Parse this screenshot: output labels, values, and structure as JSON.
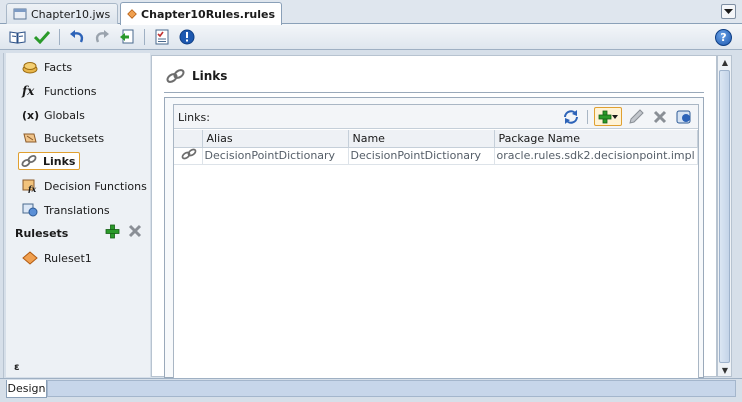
{
  "tabs": [
    {
      "label": "Chapter10.jws",
      "active": false
    },
    {
      "label": "Chapter10Rules.rules",
      "active": true
    }
  ],
  "toolbar": {
    "buttons": [
      "book-icon",
      "validate-check-icon",
      "undo-icon",
      "redo-icon",
      "export-icon",
      "report-icon",
      "info-icon"
    ],
    "help_label": "?"
  },
  "nav": {
    "items": [
      {
        "label": "Facts",
        "icon": "facts-icon"
      },
      {
        "label": "Functions",
        "icon": "functions-fx-icon"
      },
      {
        "label": "Globals",
        "icon": "globals-x-icon"
      },
      {
        "label": "Bucketsets",
        "icon": "bucketsets-icon"
      },
      {
        "label": "Links",
        "icon": "links-icon",
        "selected": true
      },
      {
        "label": "Decision Functions",
        "icon": "decision-functions-icon"
      },
      {
        "label": "Translations",
        "icon": "translations-icon"
      }
    ],
    "rulesets_label": "Rulesets",
    "rulesets": [
      {
        "label": "Ruleset1",
        "icon": "ruleset-icon"
      }
    ],
    "bottom_glyph": "ε"
  },
  "main": {
    "title": "Links",
    "links_label": "Links:",
    "columns": [
      "",
      "Alias",
      "Name",
      "Package Name"
    ],
    "rows": [
      {
        "alias": "DecisionPointDictionary",
        "name": "DecisionPointDictionary",
        "package": "oracle.rules.sdk2.decisionpoint.impl"
      }
    ]
  },
  "bottom": {
    "design_tab": "Design"
  },
  "colors": {
    "selection_border": "#e0a030",
    "add_green": "#2a9a2a",
    "delete_gray": "#7a7a7a",
    "header_bg": "#dfe6ee"
  }
}
